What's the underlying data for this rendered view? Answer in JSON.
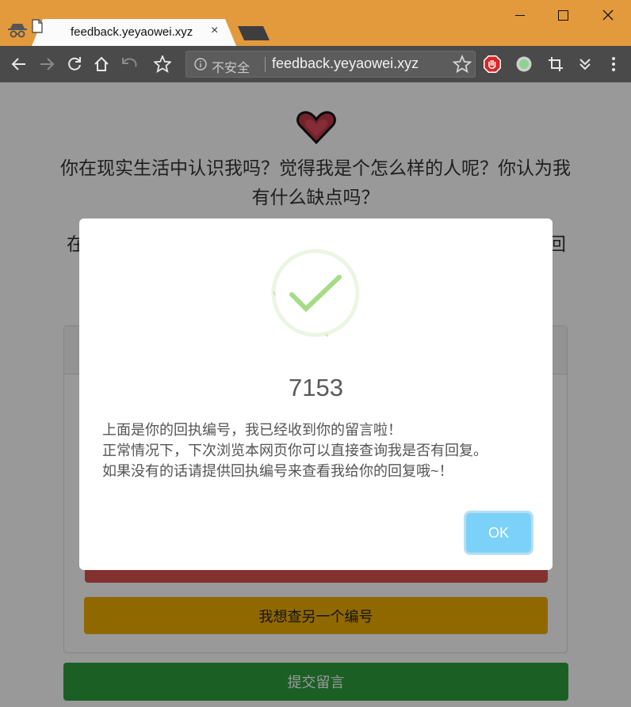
{
  "browser": {
    "tab_title": "feedback.yeyaowei.xyz",
    "tab_close": "×",
    "security_label": "不安全",
    "url": "feedback.yeyaowei.xyz"
  },
  "page": {
    "question": "你在现实生活中认识我吗？觉得我是个怎么样的人呢？你认为我有什么缺点吗？",
    "partial_left": "在",
    "partial_right": "回",
    "lookup_button": "我想查另一个编号",
    "submit_button": "提交留言"
  },
  "modal": {
    "receipt_number": "7153",
    "message_lines": [
      "上面是你的回执编号，我已经收到你的留言啦！",
      "正常情况下，下次浏览本网页你可以直接查询我是否有回复。",
      "如果没有的话请提供回执编号来查看我给你的回复哦~！"
    ],
    "ok_label": "OK"
  },
  "colors": {
    "titlebar": "#e39a3c",
    "toolbar": "#4a4a4a",
    "success_green": "#a5dc86",
    "ok_button": "#7cd1f9",
    "lookup_button": "#f0ad00",
    "submit_button": "#2d9e3e"
  },
  "icons": [
    "incognito-icon",
    "document-icon",
    "back-icon",
    "forward-icon",
    "reload-icon",
    "home-icon",
    "undo-icon",
    "star-icon",
    "info-icon",
    "adblock-icon",
    "extension-icon",
    "crop-icon",
    "chevrons-down-icon",
    "more-icon",
    "heart-icon",
    "success-checkmark-icon"
  ]
}
